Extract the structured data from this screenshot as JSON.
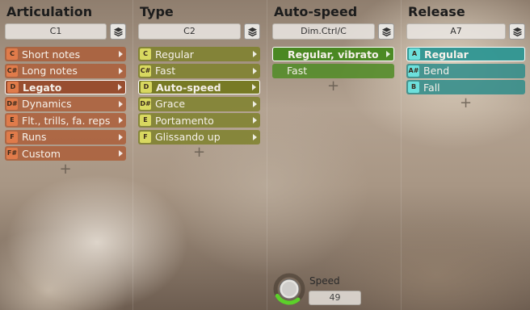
{
  "columns": [
    {
      "title": "Articulation",
      "selector": "C1",
      "color": "orange",
      "items": [
        {
          "key": "C",
          "label": "Short notes",
          "arrow": true
        },
        {
          "key": "C#",
          "label": "Long notes",
          "arrow": true
        },
        {
          "key": "D",
          "label": "Legato",
          "arrow": true,
          "selected": true
        },
        {
          "key": "D#",
          "label": "Dynamics",
          "arrow": true
        },
        {
          "key": "E",
          "label": "Flt., trills, fa. reps",
          "arrow": true
        },
        {
          "key": "F",
          "label": "Runs",
          "arrow": true
        },
        {
          "key": "F#",
          "label": "Custom",
          "arrow": true
        }
      ],
      "add_symbol": "+"
    },
    {
      "title": "Type",
      "selector": "C2",
      "color": "olive",
      "items": [
        {
          "key": "C",
          "label": "Regular",
          "arrow": true
        },
        {
          "key": "C#",
          "label": "Fast",
          "arrow": true
        },
        {
          "key": "D",
          "label": "Auto-speed",
          "arrow": true,
          "selected": true
        },
        {
          "key": "D#",
          "label": "Grace",
          "arrow": true
        },
        {
          "key": "E",
          "label": "Portamento",
          "arrow": true
        },
        {
          "key": "F",
          "label": "Glissando up",
          "arrow": true
        }
      ],
      "add_symbol": "+"
    },
    {
      "title": "Auto-speed",
      "selector": "Dim.Ctrl/C",
      "color": "green",
      "items": [
        {
          "key": "",
          "label": "Regular, vibrato",
          "arrow": true,
          "selected": true
        },
        {
          "key": "",
          "label": "Fast",
          "arrow": false
        }
      ],
      "add_symbol": "+"
    },
    {
      "title": "Release",
      "selector": "A7",
      "color": "teal",
      "items": [
        {
          "key": "A",
          "label": "Regular",
          "arrow": false,
          "selected": true
        },
        {
          "key": "A#",
          "label": "Bend",
          "arrow": false
        },
        {
          "key": "B",
          "label": "Fall",
          "arrow": false
        }
      ],
      "add_symbol": "+"
    }
  ],
  "speed": {
    "label": "Speed",
    "value": "49"
  },
  "colors": {
    "orange": "#e07b4a",
    "olive": "#d8d860",
    "green": "#58a82c",
    "teal": "#6de0dc",
    "knob_arc": "#5cd02a"
  },
  "icons": {
    "stack": "layers-icon",
    "arrow": "chevron-right-icon",
    "knob": "speed-knob"
  }
}
